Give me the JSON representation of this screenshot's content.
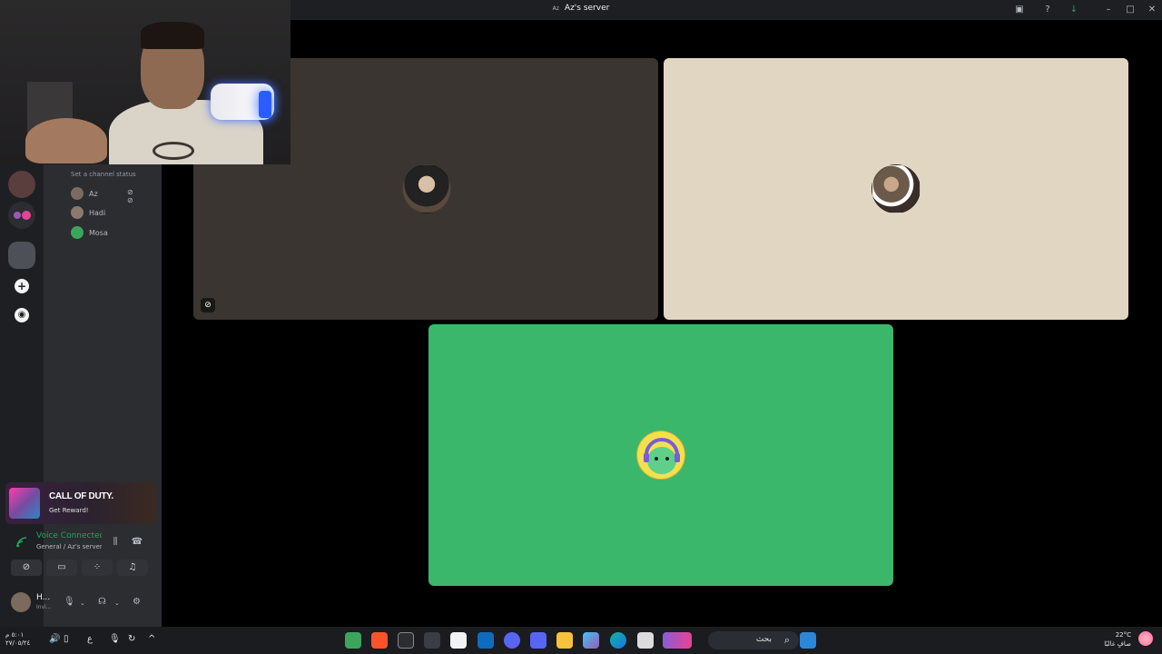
{
  "window": {
    "title": "Az's server",
    "server_icon_text": "Az"
  },
  "channel_panel": {
    "channel_status_placeholder": "Set a channel status",
    "voice_users": [
      {
        "name": "Az",
        "avatar_color": "#7b6a5e",
        "muted": true
      },
      {
        "name": "Hadi",
        "avatar_color": "#8a7a6e",
        "muted": false
      },
      {
        "name": "Mosa",
        "avatar_color": "#3ba55c",
        "muted": false
      }
    ]
  },
  "promo": {
    "brand": "CALL OF DUTY.",
    "cta": "Get Reward!"
  },
  "voice_status": {
    "title": "Voice Connected",
    "subtitle": "General / Az's server",
    "accent": "#23a55a"
  },
  "user_panel": {
    "username": "H...",
    "status": "Invi..."
  },
  "stage": {
    "tiles": [
      {
        "name": "tile-az",
        "bg": "#3a3530",
        "avatar_bg": "#5a4a3e",
        "video_off": true
      },
      {
        "name": "tile-hadi",
        "bg": "#e0d6c2",
        "avatar_bg": "#6b5a4a",
        "video_off": false
      },
      {
        "name": "tile-mosa",
        "bg": "#3bb76c",
        "avatar_bg": "#f4e04d",
        "video_off": false
      }
    ]
  },
  "taskbar": {
    "time": "٥:٠١ م",
    "date": "٢٧/٠٥/٢٤",
    "search_text": "بحث",
    "temperature": "22°C",
    "weather_desc": "صافٍ غالبًا",
    "lang": "ع"
  }
}
